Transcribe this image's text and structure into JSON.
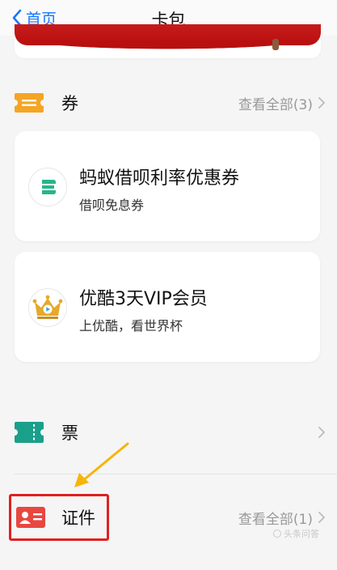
{
  "navbar": {
    "back_label": "首页",
    "title": "卡包"
  },
  "coupons_section": {
    "label": "券",
    "view_all": "查看全部(3)"
  },
  "coupons": [
    {
      "title": "蚂蚁借呗利率优惠券",
      "subtitle": "借呗免息券"
    },
    {
      "title": "优酷3天VIP会员",
      "subtitle": "上优酷，看世界杯"
    }
  ],
  "tickets_section": {
    "label": "票"
  },
  "ids_section": {
    "label": "证件",
    "view_all": "查看全部(1)"
  },
  "watermark": {
    "text": "头条问答"
  },
  "colors": {
    "accent": "#1677ff",
    "coupon_icon": "#f5a524",
    "ticket_icon": "#1aa08a",
    "id_icon": "#e8473f",
    "highlight": "#e02020",
    "arrow": "#f5b50a"
  }
}
